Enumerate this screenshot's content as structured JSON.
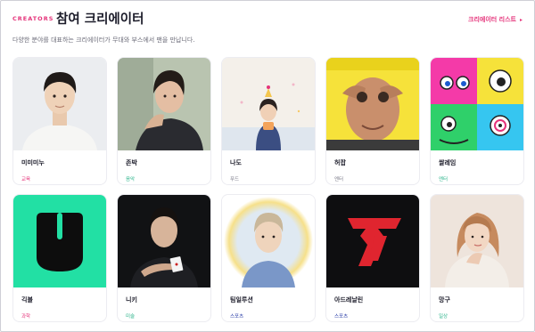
{
  "header": {
    "eyebrow": "CREATORS",
    "title": "참여 크리에이터",
    "list_link": "크리에이터 리스트",
    "subtitle": "다양한 분야를 대표하는 크리에이터가 무대와 부스에서 팬을 만납니다."
  },
  "colors": {
    "accent": "#e5337a"
  },
  "creators": [
    {
      "name": "미미미누",
      "category": "교육",
      "category_color": "#e5337a",
      "photo": "man-portrait-white-sweater-photo"
    },
    {
      "name": "존박",
      "category": "음악",
      "category_color": "#2bb38a",
      "photo": "man-portrait-leaning-photo"
    },
    {
      "name": "나도",
      "category": "푸드",
      "category_color": "#7a7a88",
      "photo": "woman-with-cake-photo"
    },
    {
      "name": "허팝",
      "category": "엔터",
      "category_color": "#7a7a88",
      "photo": "man-hand-mask-photo"
    },
    {
      "name": "쌀레임",
      "category": "엔터",
      "category_color": "#2bb38a",
      "photo": "cartoon-faces-photo"
    },
    {
      "name": "긱블",
      "category": "과학",
      "category_color": "#e5337a",
      "photo": "geekble-logo"
    },
    {
      "name": "니키",
      "category": "미술",
      "category_color": "#2bb38a",
      "photo": "man-holding-card-photo"
    },
    {
      "name": "팀일루션",
      "category": "스포츠",
      "category_color": "#2b3ea8",
      "photo": "man-circle-portrait-photo"
    },
    {
      "name": "아드레날린",
      "category": "스포츠",
      "category_color": "#2b3ea8",
      "photo": "adrenaline-logo"
    },
    {
      "name": "망구",
      "category": "일상",
      "category_color": "#2bb38a",
      "photo": "woman-portrait-photo"
    }
  ]
}
